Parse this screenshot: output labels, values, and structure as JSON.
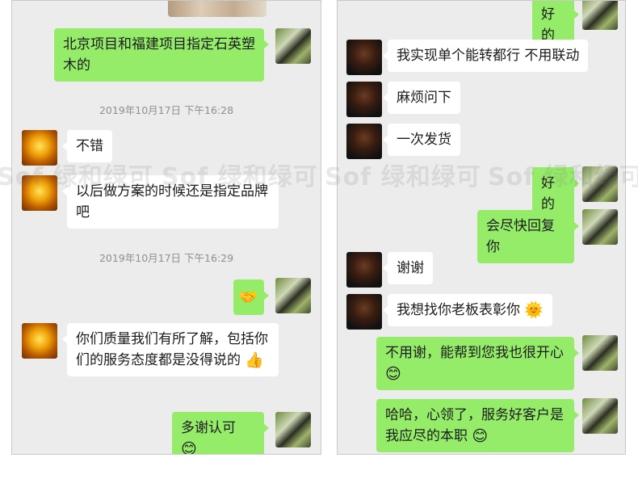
{
  "left": {
    "msg1": "北京项目和福建项目指定石英塑木的",
    "time1": "2019年10月17日 下午16:28",
    "msg2": "不错",
    "msg3": "以后做方案的时候还是指定品牌吧",
    "time2": "2019年10月17日 下午16:29",
    "msg4_emoji": "🤝",
    "msg5": "你们质量我们有所了解，包括你们的服务态度都是没得说的",
    "msg5_emoji": "👍",
    "msg6": "多谢认可",
    "msg6_emoji": "😊"
  },
  "right": {
    "msg1": "好的",
    "msg2": "我实现单个能转都行 不用联动",
    "msg3": "麻烦问下",
    "msg4": "一次发货",
    "msg5": "好的",
    "msg6": "会尽快回复你",
    "msg7": "谢谢",
    "msg8": "我想找你老板表彰你",
    "msg8_emoji": "🌞",
    "msg9": "不用谢，能帮到您我也很开心",
    "msg9_emoji": "😊",
    "msg10": "哈哈，心领了，服务好客户是我应尽的本职",
    "msg10_emoji": "😊"
  },
  "watermark": "Sof 绿和绿可",
  "colors": {
    "my_bubble": "#95ec69",
    "their_bubble": "#ffffff",
    "background": "#ececec"
  }
}
